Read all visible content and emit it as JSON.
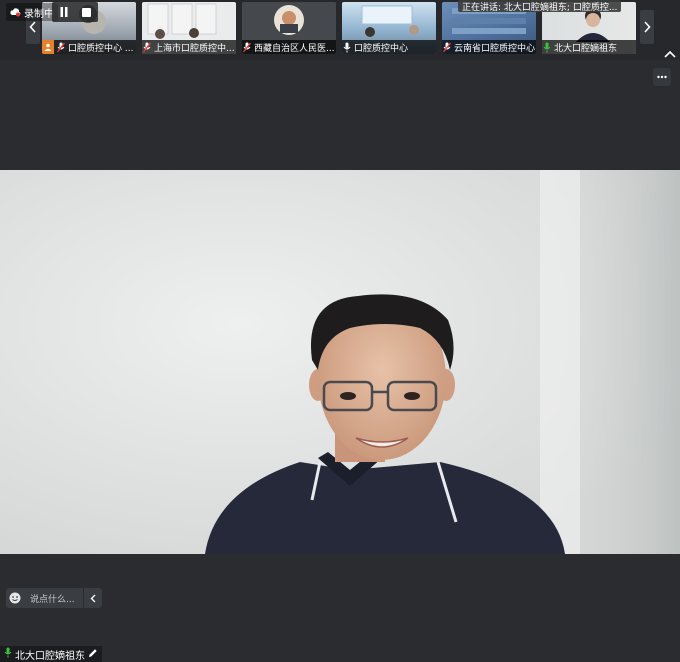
{
  "recording": {
    "label": "录制中"
  },
  "speaking": {
    "label": "正在讲话:",
    "names": "北大口腔嫡祖东; 口腔质控..."
  },
  "tiles": [
    {
      "name": "口腔质控中心 ...",
      "mic": "muted"
    },
    {
      "name": "上海市口腔质控中...",
      "mic": "muted"
    },
    {
      "name": "西藏自治区人民医...",
      "mic": "muted"
    },
    {
      "name": "口腔质控中心",
      "mic": "on"
    },
    {
      "name": "云南省口腔质控中心",
      "mic": "muted"
    },
    {
      "name": "北大口腔嫡祖东",
      "mic": "active"
    }
  ],
  "chat": {
    "placeholder": "说点什么..."
  },
  "main_speaker": {
    "name": "北大口腔嫡祖东"
  },
  "colors": {
    "accent_green": "#3cc23c",
    "muted_red": "#e23b3b",
    "bg": "#2a2c30"
  }
}
